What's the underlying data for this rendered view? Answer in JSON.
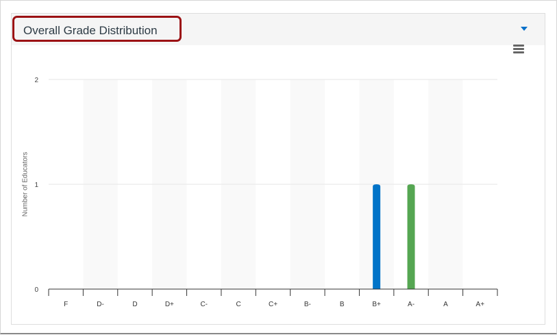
{
  "header": {
    "title": "Overall Grade Distribution",
    "dropdown_icon": "caret-down-icon",
    "menu_icon": "hamburger-menu-icon"
  },
  "colors": {
    "blue": "#0174c8",
    "green": "#55a652",
    "highlight": "#9b1114"
  },
  "chart_data": {
    "type": "bar",
    "title": "",
    "xlabel": "",
    "ylabel": "Number of Educators",
    "categories": [
      "F",
      "D-",
      "D",
      "D+",
      "C-",
      "C",
      "C+",
      "B-",
      "B",
      "B+",
      "A-",
      "A",
      "A+"
    ],
    "values": [
      0,
      0,
      0,
      0,
      0,
      0,
      0,
      0,
      0,
      1,
      1,
      0,
      0
    ],
    "bar_colors": {
      "B+": "#0174c8",
      "A-": "#55a652"
    },
    "ylim": [
      0,
      2
    ],
    "yticks": [
      "0",
      "1",
      "2"
    ],
    "grid": true
  }
}
